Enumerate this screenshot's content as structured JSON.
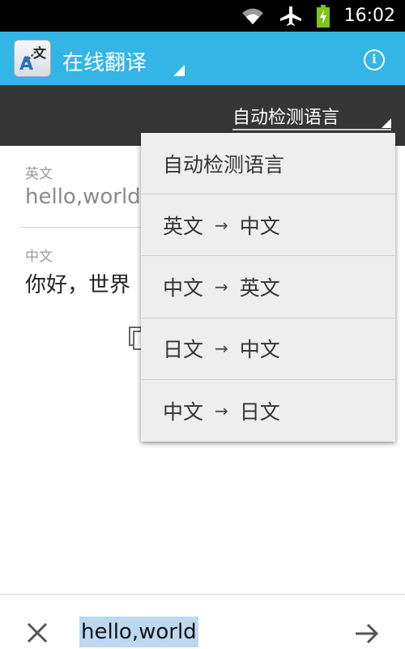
{
  "status_bar": {
    "time": "16:02",
    "icons": [
      "wifi-icon",
      "airplane-icon",
      "battery-charging-icon"
    ]
  },
  "action_bar": {
    "app_icon": "translate-app-icon",
    "title": "在线翻译",
    "info_icon": "info-icon"
  },
  "language_selector": {
    "selected": "自动检测语言"
  },
  "source": {
    "label": "英文",
    "text": "hello,world"
  },
  "target": {
    "label": "中文",
    "text": "你好，世界"
  },
  "dropdown": {
    "items": [
      {
        "label": "自动检测语言"
      },
      {
        "from": "英文",
        "arrow": "→",
        "to": "中文"
      },
      {
        "from": "中文",
        "arrow": "→",
        "to": "英文"
      },
      {
        "from": "日文",
        "arrow": "→",
        "to": "中文"
      },
      {
        "from": "中文",
        "arrow": "→",
        "to": "日文"
      }
    ]
  },
  "input_bar": {
    "value": "hello,world",
    "clear_icon": "close-icon",
    "send_icon": "arrow-right-icon"
  },
  "colors": {
    "action_bar": "#33b5e5",
    "selector_bar": "#363636",
    "dropdown_bg": "#eeeeee",
    "selection_highlight": "#bdd9f2"
  }
}
